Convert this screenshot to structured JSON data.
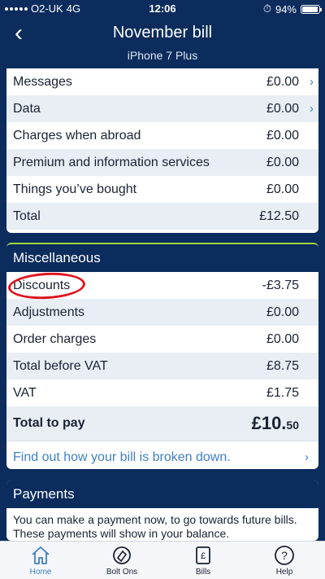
{
  "status_bar": {
    "carrier": "O2-UK",
    "network": "4G",
    "time": "12:06",
    "battery": "94%",
    "battery_level": 0.94
  },
  "header": {
    "title": "November bill",
    "subtitle": "iPhone 7 Plus",
    "back_icon": "chevron-left-icon"
  },
  "summary": {
    "rows": [
      {
        "label": "Messages",
        "amount": "£0.00",
        "chevron": true
      },
      {
        "label": "Data",
        "amount": "£0.00",
        "chevron": true
      },
      {
        "label": "Charges when abroad",
        "amount": "£0.00",
        "chevron": false
      },
      {
        "label": "Premium and information services",
        "amount": "£0.00",
        "chevron": false
      },
      {
        "label": "Things you’ve bought",
        "amount": "£0.00",
        "chevron": false
      },
      {
        "label": "Total",
        "amount": "£12.50",
        "chevron": false
      }
    ]
  },
  "misc": {
    "title": "Miscellaneous",
    "rows": [
      {
        "label": "Discounts",
        "amount": "-£3.75"
      },
      {
        "label": "Adjustments",
        "amount": "£0.00"
      },
      {
        "label": "Order charges",
        "amount": "£0.00"
      },
      {
        "label": "Total before VAT",
        "amount": "£8.75"
      },
      {
        "label": "VAT",
        "amount": "£1.75"
      }
    ],
    "total_label": "Total to pay",
    "total_pounds": "£10.",
    "total_pence": "50",
    "link_text": "Find out how your bill is broken down."
  },
  "payments": {
    "title": "Payments",
    "text": "You can make a payment now, to go towards future bills. These payments will show in your balance."
  },
  "tabs": [
    {
      "label": "Home",
      "icon": "home-icon",
      "active": true
    },
    {
      "label": "Bolt Ons",
      "icon": "bolt-ons-icon",
      "active": false
    },
    {
      "label": "Bills",
      "icon": "bills-icon",
      "active": false
    },
    {
      "label": "Help",
      "icon": "help-icon",
      "active": false
    }
  ],
  "colors": {
    "navy": "#0b2c5c",
    "accent_blue": "#3e7fc2",
    "alt_row": "#e9eef4",
    "annotation_red": "#e0141f",
    "green_line": "#9fd642"
  }
}
